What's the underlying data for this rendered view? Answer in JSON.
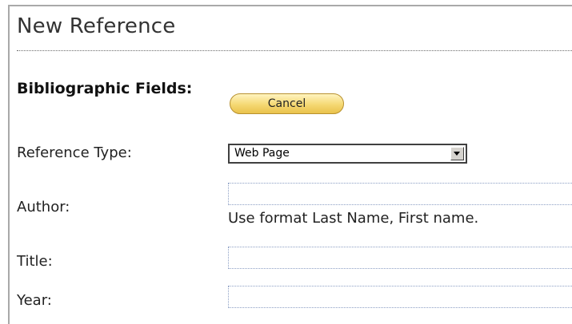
{
  "form": {
    "title": "New Reference",
    "section_label": "Bibliographic Fields:",
    "cancel_label": "Cancel",
    "reference_type": {
      "label": "Reference Type:",
      "selected": "Web Page"
    },
    "author": {
      "label": "Author:",
      "value": "",
      "hint": "Use format Last Name, First name."
    },
    "title_field": {
      "label": "Title:",
      "value": ""
    },
    "year": {
      "label": "Year:",
      "value": ""
    }
  },
  "colors": {
    "button_fill": "#f5d873",
    "button_border": "#b8912f",
    "field_border": "#8c9fc4",
    "panel_border": "#a9a9a9"
  },
  "icons": {
    "select_arrow": "chevron-down-icon"
  }
}
